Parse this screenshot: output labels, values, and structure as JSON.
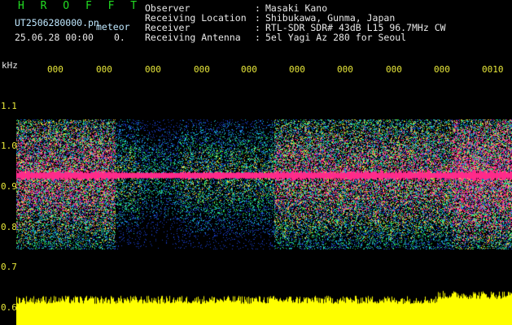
{
  "app": {
    "title": "H R O F F T",
    "file_name": "UT2506280000.pn",
    "mode_label": "meteor",
    "date_time": "25.06.28 00:00",
    "zero_mark": "0."
  },
  "header": {
    "rows": [
      {
        "label": "Observer",
        "value": "Masaki Kano"
      },
      {
        "label": "Receiving Location",
        "value": "Shibukawa, Gunma, Japan"
      },
      {
        "label": "Receiver",
        "value": "RTL-SDR SDR# 43dB L15 96.7MHz CW"
      },
      {
        "label": "Receiving Antenna",
        "value": "5el Yagi Az 280 for Seoul"
      }
    ]
  },
  "axes": {
    "freq_unit": "kHz",
    "freq_ticks": [
      "1.1",
      "1.0",
      "0.9",
      "0.8",
      "0.7",
      "0.6"
    ],
    "time_ticks": [
      "000",
      "000",
      "000",
      "000",
      "000",
      "000",
      "000",
      "000",
      "000",
      "0010"
    ]
  },
  "colors": {
    "background": "#000000",
    "title": "#22dd22",
    "text": "#e8e8e8",
    "tick_labels": "#e8e83a",
    "echo_line": "#ff2a8a",
    "amplitude": "#ffff00"
  }
}
